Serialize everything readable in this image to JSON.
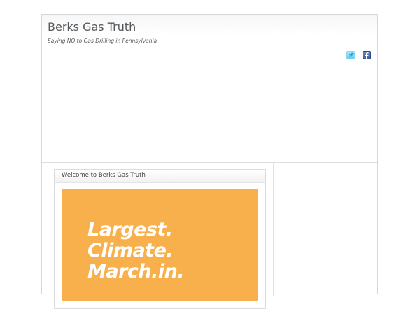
{
  "site": {
    "title": "Berks Gas Truth",
    "description": "Saying NO to Gas Drilling in Pennsylvania"
  },
  "social": {
    "twitter_icon": "twitter-icon",
    "facebook_icon": "facebook-icon"
  },
  "widget": {
    "title": "Welcome to Berks Gas Truth",
    "poster_lines": [
      "Largest.",
      "Climate.",
      "March.in."
    ],
    "poster_color": "#f8b04c"
  }
}
